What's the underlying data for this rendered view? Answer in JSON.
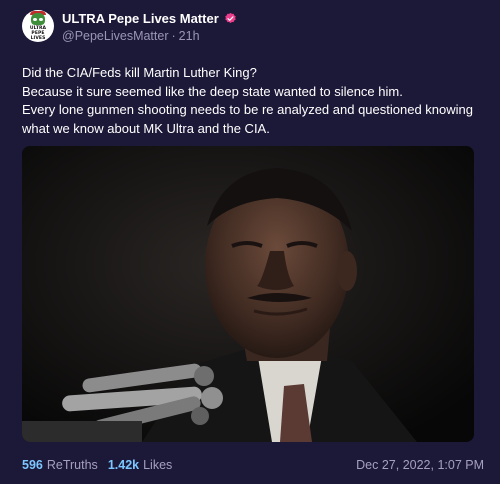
{
  "post": {
    "avatar_text": [
      "ULTRA",
      "PEPE",
      "LIVES",
      "MATTER"
    ],
    "display_name": "ULTRA Pepe Lives Matter",
    "handle": "@PepeLivesMatter",
    "separator": "·",
    "age": "21h",
    "body_lines": [
      "Did the CIA/Feds kill Martin Luther King?",
      "Because it sure seemed like the deep state wanted to silence him.",
      "Every lone gunmen shooting needs to be re analyzed and questioned knowing what we know about MK Ultra and the CIA."
    ],
    "retruths_count": "596",
    "retruths_label": "ReTruths",
    "likes_count": "1.42k",
    "likes_label": "Likes",
    "timestamp": "Dec 27, 2022, 1:07 PM"
  },
  "colors": {
    "background": "#1c1838",
    "accent": "#7cc7ff",
    "muted": "#a5a0c0",
    "verified_badge": "#e83e8c"
  },
  "icons": {
    "verified": "verified-badge-icon"
  }
}
